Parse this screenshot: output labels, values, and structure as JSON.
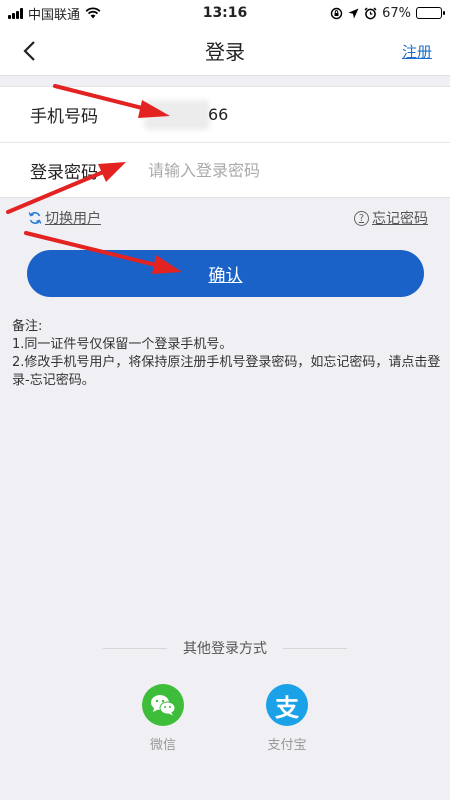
{
  "status_bar": {
    "carrier": "中国联通",
    "time": "13:16",
    "battery": "67%",
    "battery_level": 0.67
  },
  "nav": {
    "title": "登录",
    "register_label": "注册",
    "back_icon": "chevron-left-icon"
  },
  "form": {
    "phone_label": "手机号码",
    "phone_value_visible": "66",
    "password_label": "登录密码",
    "password_placeholder": "请输入登录密码"
  },
  "links": {
    "switch_user": "切换用户",
    "forgot_password": "忘记密码"
  },
  "confirm_label": "确认",
  "notes": {
    "title": "备注:",
    "line1": "1.同一证件号仅保留一个登录手机号。",
    "line2": "2.修改手机号用户，将保持原注册手机号登录密码，如忘记密码，请点击登录-忘记密码。"
  },
  "other_login": {
    "title": "其他登录方式",
    "wechat_label": "微信",
    "alipay_label": "支付宝",
    "alipay_glyph": "支"
  },
  "colors": {
    "primary": "#1a62c8",
    "link": "#1a6fc9",
    "wechat": "#3ebd3b",
    "alipay": "#1aa1e8",
    "arrow": "#e32222"
  }
}
